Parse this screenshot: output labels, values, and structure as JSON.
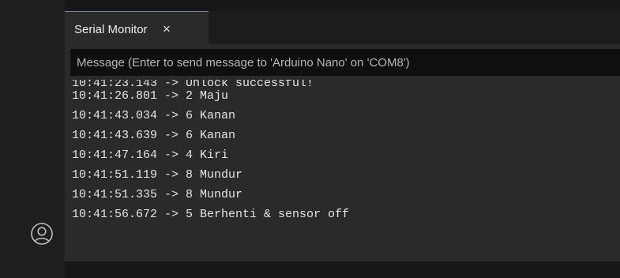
{
  "tab": {
    "label": "Serial Monitor",
    "close": "×"
  },
  "input": {
    "placeholder": "Message (Enter to send message to 'Arduino Nano' on 'COM8')"
  },
  "lines": [
    "10:41:23.143 -> Unlock successful!",
    "10:41:26.801 -> 2 Maju",
    "10:41:43.034 -> 6 Kanan",
    "10:41:43.639 -> 6 Kanan",
    "10:41:47.164 -> 4 Kiri",
    "10:41:51.119 -> 8 Mundur",
    "10:41:51.335 -> 8 Mundur",
    "10:41:56.672 -> 5 Berhenti & sensor off"
  ],
  "icons": {
    "sidebar_bottom": "account-icon",
    "tab_close": "close-icon"
  }
}
